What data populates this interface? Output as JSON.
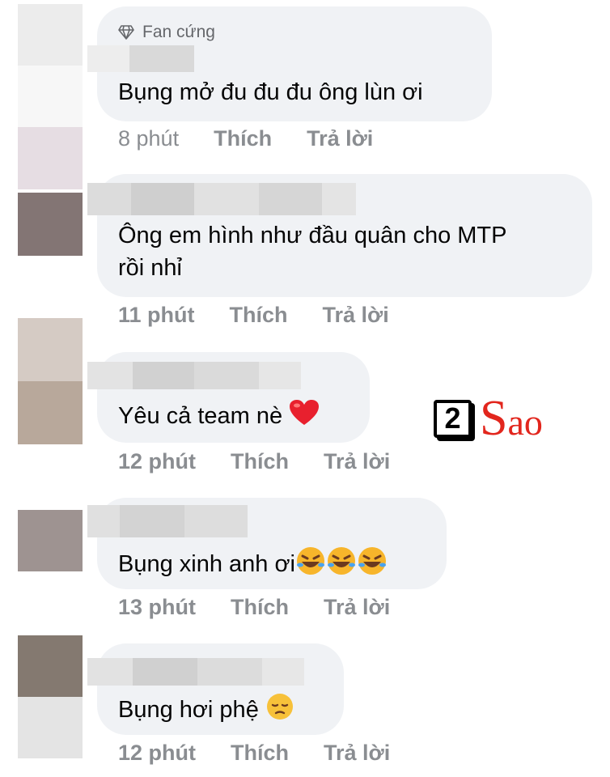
{
  "comments": [
    {
      "badge": "Fan cứng",
      "text": "Bụng mở đu đu đu ông lùn ơi",
      "time": "8 phút",
      "like": "Thích",
      "reply": "Trả lời"
    },
    {
      "text_line1": "Ông em hình như đầu quân cho MTP",
      "text_line2": "rồi nhỉ",
      "time": "11 phút",
      "like": "Thích",
      "reply": "Trả lời"
    },
    {
      "text": "Yêu cả team nè",
      "emoji": "red-heart",
      "time": "12 phút",
      "like": "Thích",
      "reply": "Trả lời"
    },
    {
      "text": "Bụng xinh anh ơi",
      "emoji": "rolling-on-floor-laughing x3",
      "time": "13 phút",
      "like": "Thích",
      "reply": "Trả lời"
    },
    {
      "text": "Bụng hơi phệ",
      "emoji": "pensive-face",
      "time": "12 phút",
      "like": "Thích",
      "reply": "Trả lời"
    }
  ],
  "watermark": {
    "box_text": "2",
    "s_text": "S",
    "rest_text": "ao",
    "brand_color": "#e2261d"
  },
  "colors": {
    "bubble": "#f0f2f5",
    "meta_text": "#8a8d91",
    "comment_text": "#050505"
  }
}
